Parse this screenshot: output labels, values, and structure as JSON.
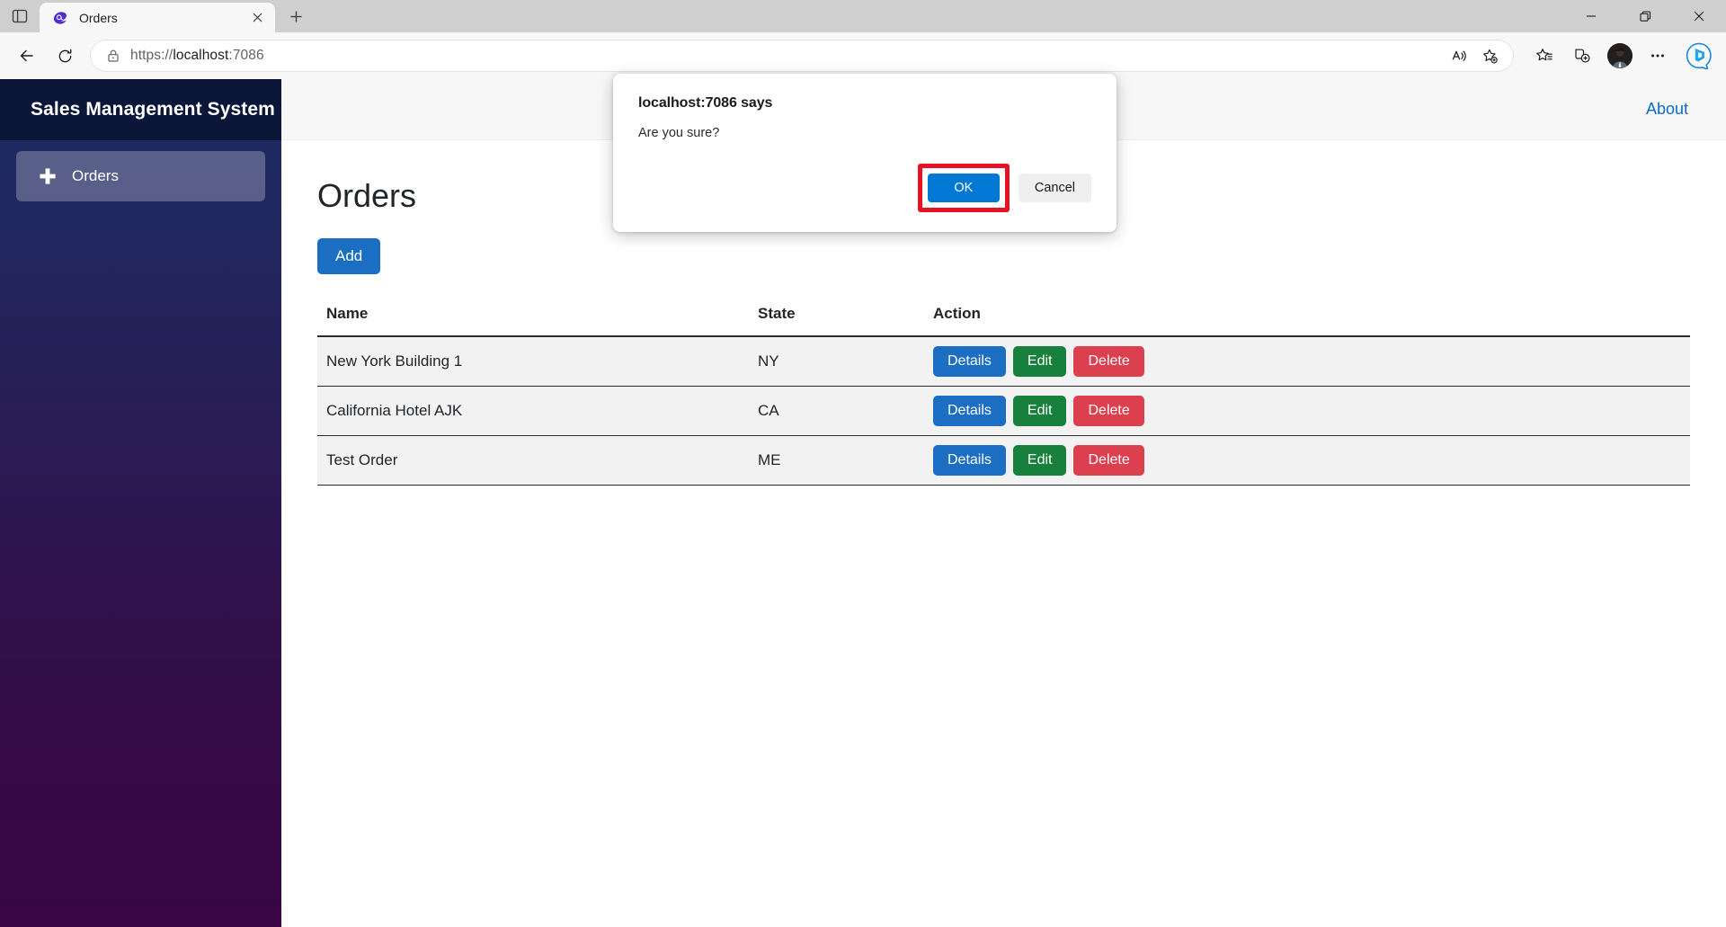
{
  "browser": {
    "tab_sidebar_icon": "tab-sidebar-icon",
    "tab": {
      "favicon": "blazor-favicon",
      "title": "Orders",
      "close_icon": "close-icon"
    },
    "new_tab_icon": "plus-icon",
    "window_controls": {
      "minimize_icon": "minimize-icon",
      "restore_icon": "restore-icon",
      "close_icon": "window-close-icon"
    },
    "toolbar": {
      "back_icon": "back-arrow-icon",
      "refresh_icon": "refresh-icon",
      "lock_icon": "lock-icon",
      "url_scheme": "https://",
      "url_host": "localhost",
      "url_port": ":7086",
      "url_full": "https://localhost:7086",
      "read_aloud_icon": "read-aloud-icon",
      "add_favorite_icon": "add-favorite-star-icon",
      "favorites_icon": "favorites-list-icon",
      "collections_icon": "collections-icon",
      "profile_icon": "profile-avatar",
      "settings_icon": "more-options-icon",
      "copilot_icon": "bing-copilot-icon"
    }
  },
  "sidebar": {
    "brand": "Sales Management System",
    "items": [
      {
        "label": "Orders",
        "icon": "plus-icon"
      }
    ]
  },
  "topbar": {
    "about_label": "About"
  },
  "page": {
    "title": "Orders",
    "add_button": "Add",
    "table": {
      "headers": [
        "Name",
        "State",
        "Action"
      ],
      "rows": [
        {
          "name": "New York Building 1",
          "state": "NY",
          "actions": [
            "Details",
            "Edit",
            "Delete"
          ]
        },
        {
          "name": "California Hotel AJK",
          "state": "CA",
          "actions": [
            "Details",
            "Edit",
            "Delete"
          ]
        },
        {
          "name": "Test Order",
          "state": "ME",
          "actions": [
            "Details",
            "Edit",
            "Delete"
          ]
        }
      ]
    }
  },
  "dialog": {
    "heading": "localhost:7086 says",
    "message": "Are you sure?",
    "ok_label": "OK",
    "cancel_label": "Cancel",
    "highlight_color": "#e81123"
  },
  "colors": {
    "primary_blue": "#1b6ec2",
    "edit_green": "#17803d",
    "delete_red": "#dc3f4e",
    "dialog_blue": "#0078d4",
    "sidebar_top": "#1b2a63",
    "sidebar_bottom": "#3a0644",
    "sidebar_header": "#0b1638",
    "about_link": "#0a6cc4"
  }
}
